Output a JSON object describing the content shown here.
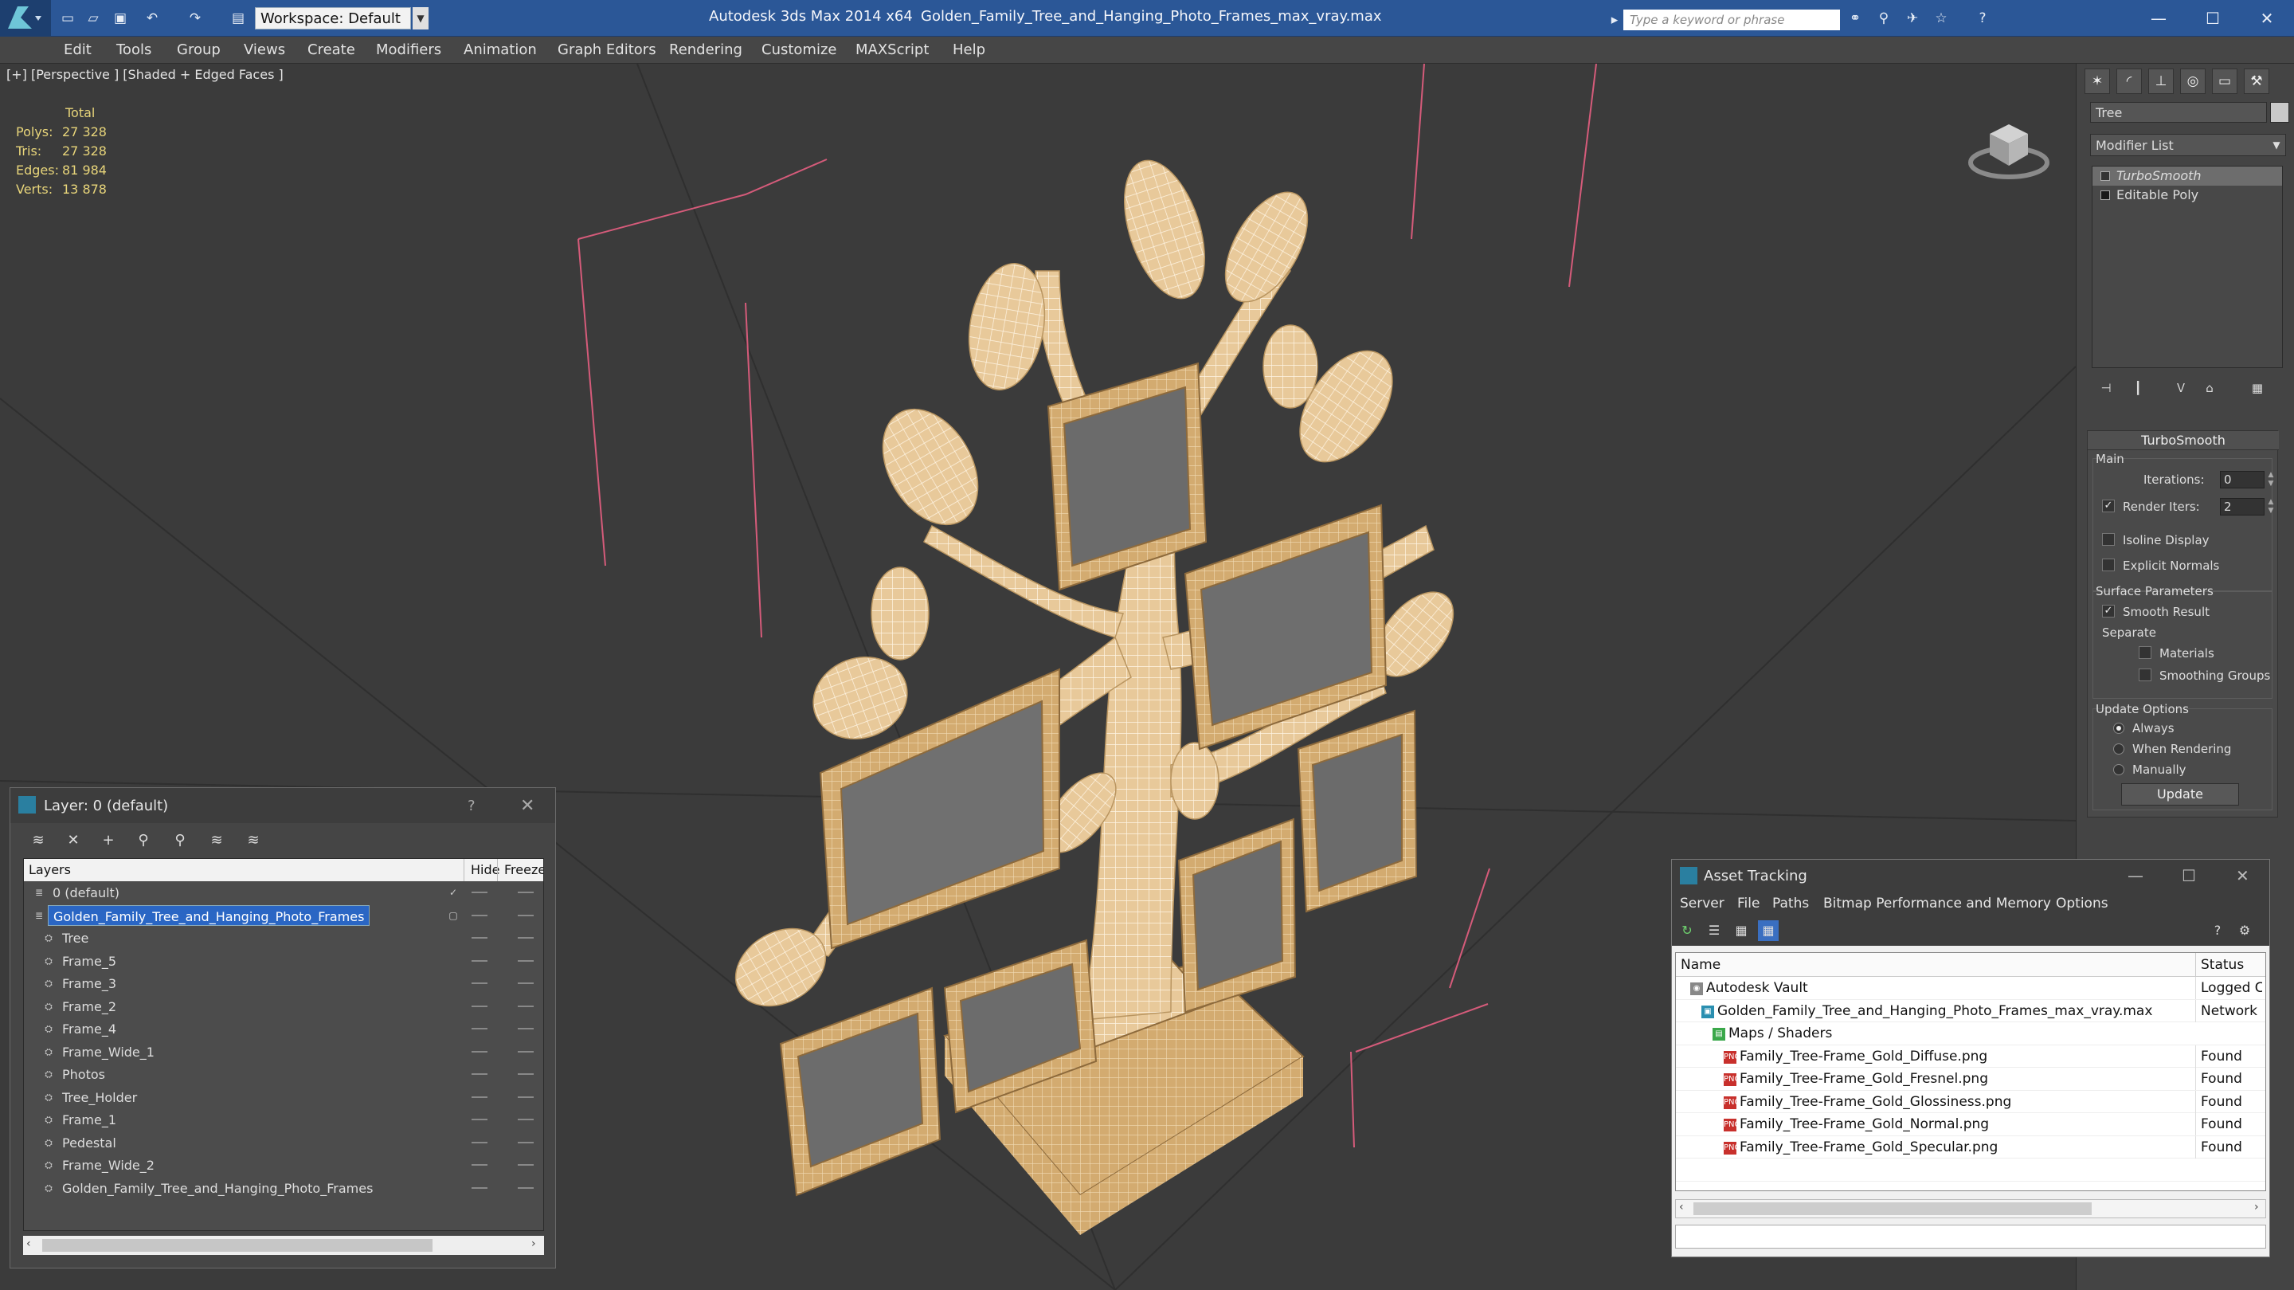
{
  "titlebar": {
    "app_title": "Autodesk 3ds Max  2014 x64",
    "file_title": "Golden_Family_Tree_and_Hanging_Photo_Frames_max_vray.max",
    "workspace": "Workspace: Default",
    "search_placeholder": "Type a keyword or phrase",
    "bg_color": "#2b5797"
  },
  "menu": [
    "Edit",
    "Tools",
    "Group",
    "Views",
    "Create",
    "Modifiers",
    "Animation",
    "Graph Editors",
    "Rendering",
    "Customize",
    "MAXScript",
    "Help"
  ],
  "viewport": {
    "label": "[+] [Perspective ] [Shaded + Edged Faces ]",
    "stats": {
      "header": "Total",
      "rows": [
        {
          "label": "Polys:",
          "value": "27 328"
        },
        {
          "label": "Tris:",
          "value": "27 328"
        },
        {
          "label": "Edges:",
          "value": "81 984"
        },
        {
          "label": "Verts:",
          "value": "13 878"
        }
      ]
    },
    "model_color": "#e8c99a"
  },
  "command_panel": {
    "object_name": "Tree",
    "modifier_list": "Modifier List",
    "stack": [
      "TurboSmooth",
      "Editable Poly"
    ],
    "rollout": {
      "title": "TurboSmooth",
      "main_label": "Main",
      "iterations_label": "Iterations:",
      "iterations_value": "0",
      "render_iters_label": "Render Iters:",
      "render_iters_value": "2",
      "render_iters_checked": true,
      "isoline_label": "Isoline Display",
      "explicit_normals_label": "Explicit Normals",
      "surface_params_label": "Surface Parameters",
      "smooth_result_label": "Smooth Result",
      "separate_label": "Separate",
      "materials_label": "Materials",
      "smoothing_groups_label": "Smoothing Groups",
      "update_options_label": "Update Options",
      "always_label": "Always",
      "when_rendering_label": "When Rendering",
      "manually_label": "Manually",
      "update_button": "Update"
    }
  },
  "layer_dialog": {
    "title": "Layer: 0 (default)",
    "help": "?",
    "columns": {
      "layers": "Layers",
      "hide": "Hide",
      "freeze": "Freeze"
    },
    "rows": [
      {
        "name": "0 (default)",
        "indent": 0,
        "kind": "layer",
        "selected": false
      },
      {
        "name": "Golden_Family_Tree_and_Hanging_Photo_Frames",
        "indent": 0,
        "kind": "layer",
        "selected": true
      },
      {
        "name": "Tree",
        "indent": 1,
        "kind": "object",
        "selected": false
      },
      {
        "name": "Frame_5",
        "indent": 1,
        "kind": "object",
        "selected": false
      },
      {
        "name": "Frame_3",
        "indent": 1,
        "kind": "object",
        "selected": false
      },
      {
        "name": "Frame_2",
        "indent": 1,
        "kind": "object",
        "selected": false
      },
      {
        "name": "Frame_4",
        "indent": 1,
        "kind": "object",
        "selected": false
      },
      {
        "name": "Frame_Wide_1",
        "indent": 1,
        "kind": "object",
        "selected": false
      },
      {
        "name": "Photos",
        "indent": 1,
        "kind": "object",
        "selected": false
      },
      {
        "name": "Tree_Holder",
        "indent": 1,
        "kind": "object",
        "selected": false
      },
      {
        "name": "Frame_1",
        "indent": 1,
        "kind": "object",
        "selected": false
      },
      {
        "name": "Pedestal",
        "indent": 1,
        "kind": "object",
        "selected": false
      },
      {
        "name": "Frame_Wide_2",
        "indent": 1,
        "kind": "object",
        "selected": false
      },
      {
        "name": "Golden_Family_Tree_and_Hanging_Photo_Frames",
        "indent": 1,
        "kind": "object",
        "selected": false
      }
    ]
  },
  "asset_dialog": {
    "title": "Asset Tracking",
    "menu": [
      "Server",
      "File",
      "Paths",
      "Bitmap Performance and Memory",
      "Options"
    ],
    "columns": {
      "name": "Name",
      "status": "Status"
    },
    "rows": [
      {
        "name": "Autodesk Vault",
        "status": "Logged C",
        "indent": 1,
        "icon": "vault-icon"
      },
      {
        "name": "Golden_Family_Tree_and_Hanging_Photo_Frames_max_vray.max",
        "status": "Network I",
        "indent": 2,
        "icon": "max-file-icon"
      },
      {
        "name": "Maps / Shaders",
        "status": "",
        "indent": 3,
        "icon": "maps-folder-icon"
      },
      {
        "name": "Family_Tree-Frame_Gold_Diffuse.png",
        "status": "Found",
        "indent": 4,
        "icon": "png-icon"
      },
      {
        "name": "Family_Tree-Frame_Gold_Fresnel.png",
        "status": "Found",
        "indent": 4,
        "icon": "png-icon"
      },
      {
        "name": "Family_Tree-Frame_Gold_Glossiness.png",
        "status": "Found",
        "indent": 4,
        "icon": "png-icon"
      },
      {
        "name": "Family_Tree-Frame_Gold_Normal.png",
        "status": "Found",
        "indent": 4,
        "icon": "png-icon"
      },
      {
        "name": "Family_Tree-Frame_Gold_Specular.png",
        "status": "Found",
        "indent": 4,
        "icon": "png-icon"
      }
    ]
  }
}
